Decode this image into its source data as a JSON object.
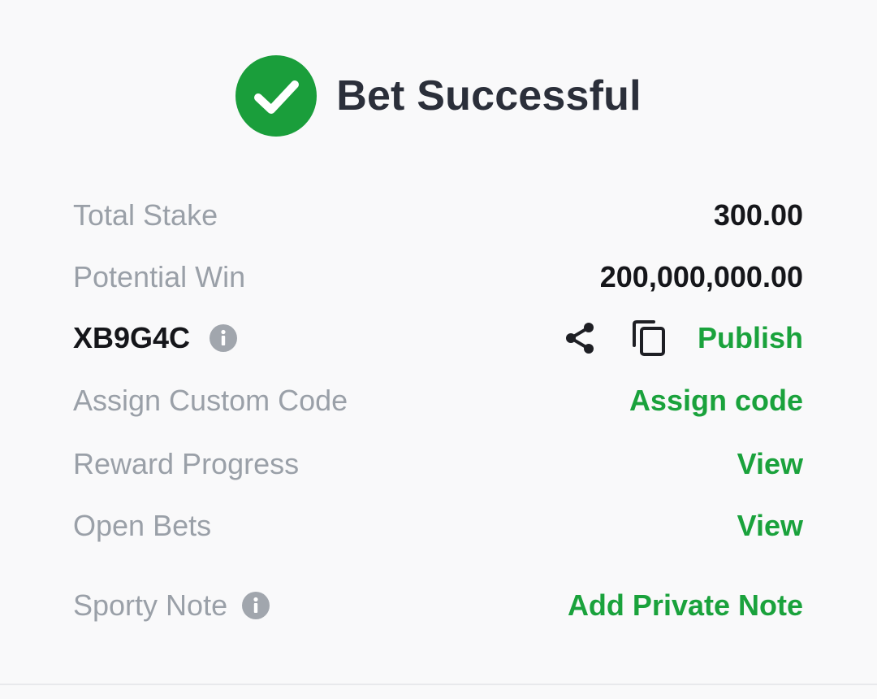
{
  "header": {
    "title": "Bet Successful",
    "icon": "check-circle-icon",
    "icon_color": "#1a9e3b"
  },
  "summary": {
    "total_stake_label": "Total Stake",
    "total_stake_value": "300.00",
    "potential_win_label": "Potential Win",
    "potential_win_value": "200,000,000.00"
  },
  "booking": {
    "code": "XB9G4C",
    "info_icon": "info-icon",
    "share_icon": "share-icon",
    "copy_icon": "copy-icon",
    "publish_label": "Publish"
  },
  "rows": {
    "custom_code_label": "Assign Custom Code",
    "custom_code_action": "Assign code",
    "reward_label": "Reward Progress",
    "reward_action": "View",
    "open_bets_label": "Open Bets",
    "open_bets_action": "View",
    "note_label": "Sporty Note",
    "note_action": "Add Private Note"
  },
  "colors": {
    "accent": "#1aa23c",
    "label": "#9aa0a8",
    "text": "#15161a",
    "title": "#2b2f3a",
    "background": "#f9f9fa"
  }
}
